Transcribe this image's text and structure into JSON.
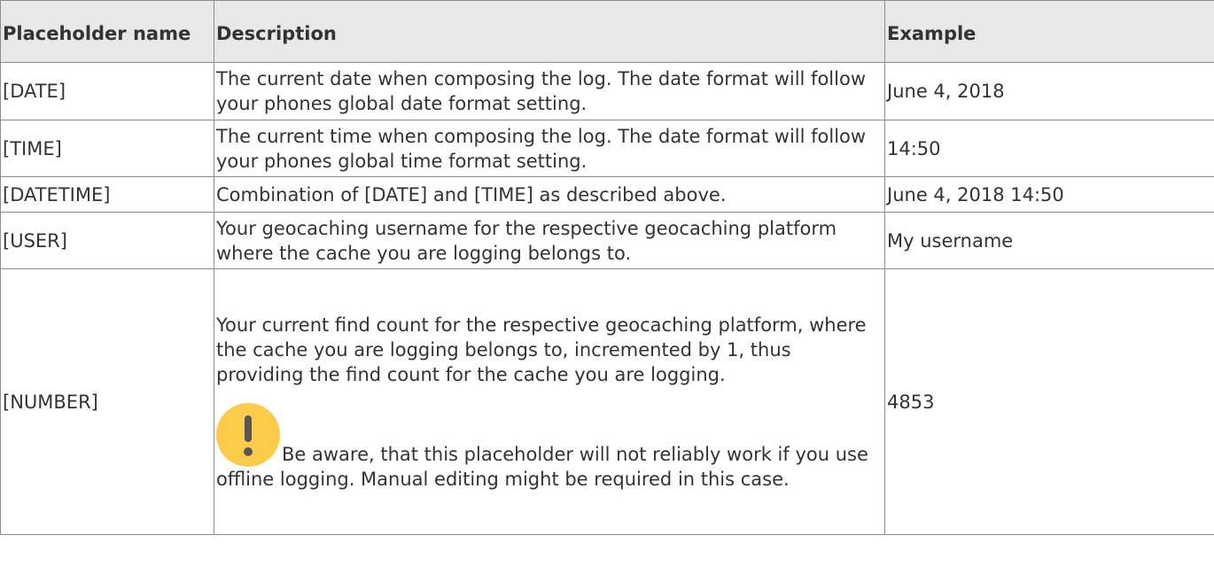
{
  "table": {
    "headers": [
      "Placeholder name",
      "Description",
      "Example"
    ],
    "rows": [
      {
        "placeholder": "[DATE]",
        "description": "The current date when composing the log. The date format will follow your phones global date format setting.",
        "example": "June 4, 2018"
      },
      {
        "placeholder": "[TIME]",
        "description": "The current time when composing the log. The date format will follow your phones global time format setting.",
        "example": "14:50"
      },
      {
        "placeholder": "[DATETIME]",
        "description": "Combination of [DATE] and [TIME] as described above.",
        "example": "June 4, 2018 14:50"
      },
      {
        "placeholder": "[USER]",
        "description": "Your geocaching username for the respective geocaching platform where the cache you are logging belongs to.",
        "example": "My username"
      },
      {
        "placeholder": "[NUMBER]",
        "description": "Your current find count for the respective geocaching platform, where the cache you are logging belongs to, incremented by 1, thus providing the find count for the cache you are logging.",
        "note": "Be aware, that this placeholder will not reliably work if you use offline logging. Manual editing might be required in this case.",
        "note_icon": "exclamation-warning-icon",
        "example": "4853"
      }
    ]
  },
  "colors": {
    "border": "#8c8c8c",
    "header_bg": "#e8e8e8",
    "text": "#333333",
    "warning_icon": "#fdcb4a"
  }
}
